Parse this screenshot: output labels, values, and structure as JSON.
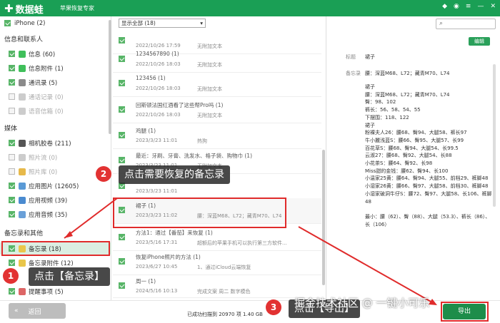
{
  "app": {
    "name": "数据蛙",
    "subtitle": "苹果恢复专家"
  },
  "sidebar": {
    "device": {
      "label": "iPhone (2)"
    },
    "sections": [
      {
        "title": "信息和联系人",
        "items": [
          {
            "label": "信息 (60)",
            "checked": true
          },
          {
            "label": "信息附件 (1)",
            "checked": true
          },
          {
            "label": "通讯录 (5)",
            "checked": true
          },
          {
            "label": "通话记录 (0)",
            "checked": false
          },
          {
            "label": "语音信箱 (0)",
            "checked": false
          }
        ]
      },
      {
        "title": "媒体",
        "items": [
          {
            "label": "相机胶卷 (211)",
            "checked": true
          },
          {
            "label": "照片流 (0)",
            "checked": false
          },
          {
            "label": "照片库 (0)",
            "checked": false
          },
          {
            "label": "应用图片 (12605)",
            "checked": true
          },
          {
            "label": "应用视频 (39)",
            "checked": true
          },
          {
            "label": "应用音频 (35)",
            "checked": true
          }
        ]
      },
      {
        "title": "备忘录和其他",
        "items": [
          {
            "label": "备忘录 (18)",
            "checked": true
          },
          {
            "label": "备忘录附件 (12)",
            "checked": true
          },
          {
            "label": "提醒事项 (5)",
            "checked": true
          }
        ]
      }
    ]
  },
  "filter": {
    "value": "显示全部 (18)"
  },
  "list_items": [
    {
      "title": "",
      "date": "2022/10/26 17:59",
      "preview": "无附加文本"
    },
    {
      "title": "1234567890 (1)",
      "date": "2022/10/26 18:03",
      "preview": "无附加文本"
    },
    {
      "title": "123456 (1)",
      "date": "2022/10/26 18:03",
      "preview": "无附加文本"
    },
    {
      "title": "回斯顿法国红酒看了这些帮Pro吗 (1)",
      "date": "2022/10/26 18:03",
      "preview": "无附加文本"
    },
    {
      "title": "鸡腿 (1)",
      "date": "2023/3/23 11:01",
      "preview": "热狗"
    },
    {
      "title": "最近：牙刷、牙膏、洗发水、格子袋、购物巾 (1)",
      "date": "2023/3/23 11:01",
      "preview": "无附加文本"
    },
    {
      "title": "",
      "date": "2023/3/23 11:01",
      "preview": ""
    },
    {
      "title": "裙子 (1)",
      "date": "2023/3/23 11:02",
      "preview": "腰：深蓝M68、L72；藏青M70、L74"
    },
    {
      "title": "方法1：通过【番茄】来恢复 (1)",
      "date": "2023/5/16 17:31",
      "preview": "超额后的苹果手机可以执行第三方软件..."
    },
    {
      "title": "恢复iPhone照片的方法 (1)",
      "date": "2023/6/27 10:45",
      "preview": "1、通过iCloud云端恢复"
    },
    {
      "title": "周一 (1)",
      "date": "2024/5/16 10:13",
      "preview": "完成文案 周二 数字模色"
    }
  ],
  "detail": {
    "search_icon": "search-icon",
    "edit_label": "编辑",
    "title_label": "标题",
    "title_value": "裙子",
    "memo_label": "备忘录",
    "memo_first": "腰：深蓝M68、L72；藏青M70、L74",
    "memo_lines": [
      "裙子",
      "腰：深蓝M68、L72；藏青M70、L74",
      "臀：98、102",
      "裤长：56、58、54、55",
      "下摆围：118、122",
      "裙子",
      "粉裸夫人26：腰68、臀94、大腿58、裤长97",
      "牛小麗浅蓝S：腰66、臀95、大腿57、长99",
      "百花草S：腰68、臀94、大腿54、长99.5",
      "云淑27：腰68、臀92、大腿54、长88",
      "小花茶S：腰64、臀92、长98",
      "Miss甜的金钱：腰62、臀94、长100",
      "小温家25黄：腰64、臀94、大腿55、前档29、裤脚48",
      "小湿家26黄：腰66、臀97、大腿58、前档30、裤脚48",
      "小湿家破洞牛仔S：腰72、臀97、大腿58、长106、裤脚48",
      "",
      "最小：腰（62）、臀（88）、大腿（53.3）、裤长（86）、长（106）"
    ]
  },
  "bottom": {
    "back_label": "返回",
    "status": "已成功扫描到 20970 项 1.40 GB",
    "export_label": "导出"
  },
  "annotations": {
    "step1": {
      "num": "1",
      "text": "点击【备忘录】"
    },
    "step2": {
      "num": "2",
      "text": "点击需要恢复的备忘录"
    },
    "step3": {
      "num": "3",
      "text": "点击【导出】"
    },
    "watermark": "掘金技术社区 @ 一键小可乐"
  }
}
